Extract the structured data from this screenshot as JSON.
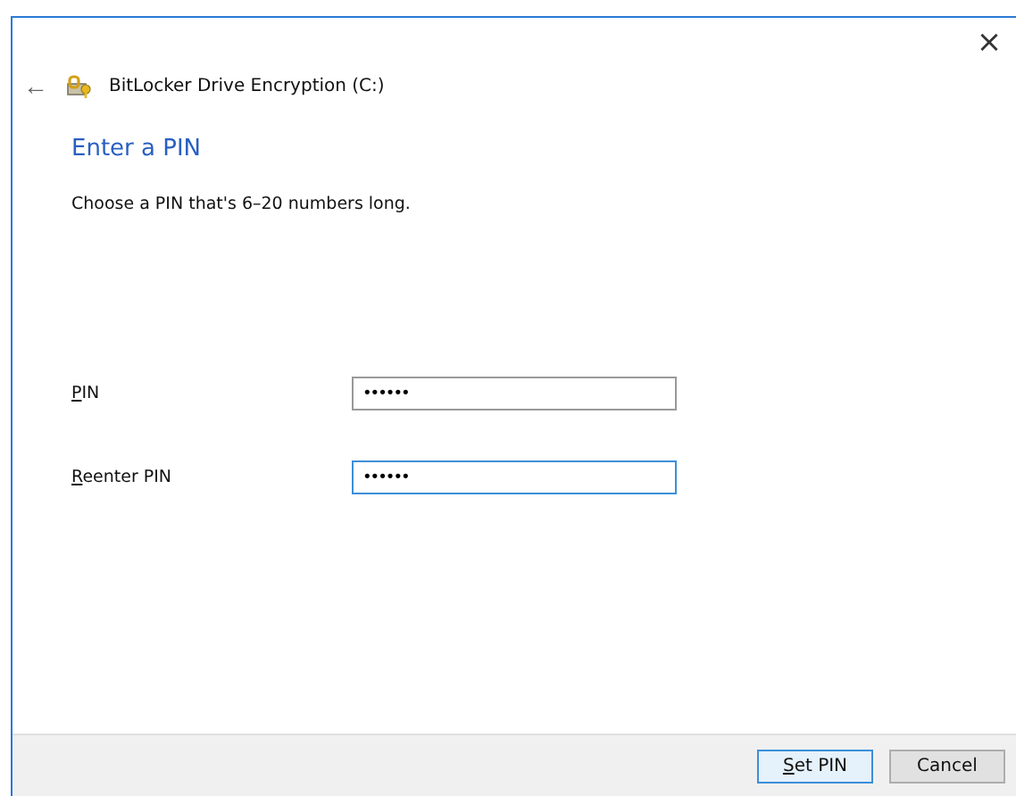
{
  "window": {
    "close": "×",
    "back": "←",
    "title": "BitLocker Drive Encryption (C:)"
  },
  "heading": "Enter a PIN",
  "description": "Choose a PIN that's 6–20 numbers long.",
  "fields": [
    {
      "label": "PIN",
      "underline_first": true,
      "value": "••••••",
      "focused": false
    },
    {
      "label": "Reenter PIN",
      "underline_first": true,
      "value": "••••••",
      "focused": true
    }
  ],
  "buttons": [
    {
      "label": "Set PIN",
      "underline_first": true,
      "default": true
    },
    {
      "label": "Cancel",
      "underline_first": false,
      "default": false
    }
  ]
}
